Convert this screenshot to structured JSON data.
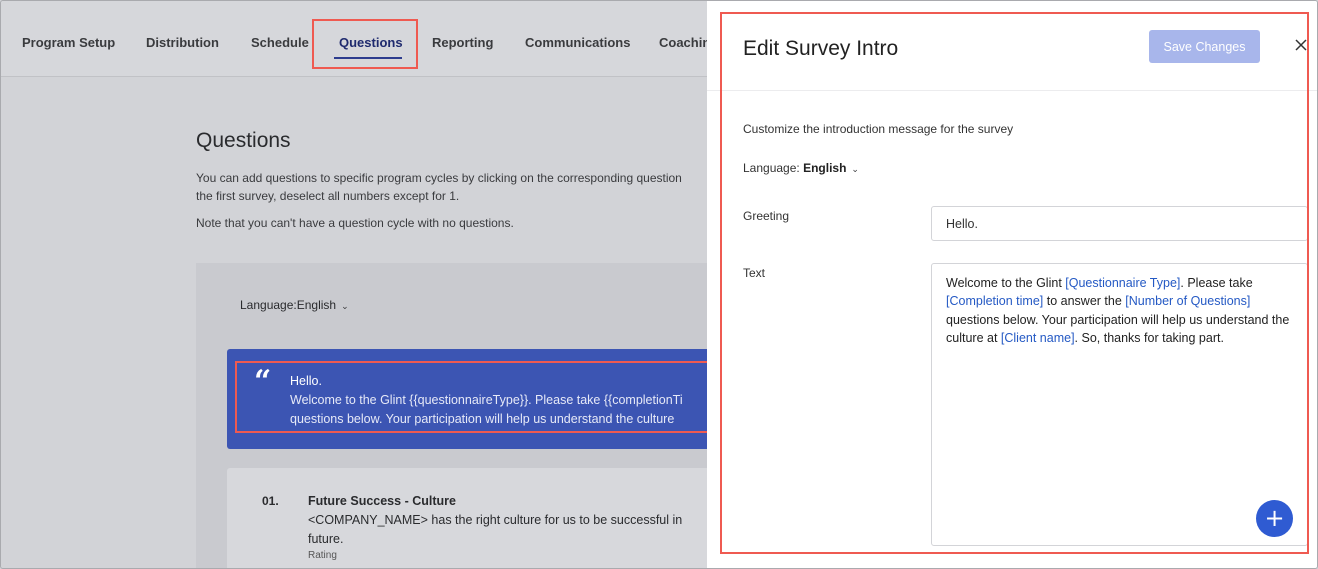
{
  "nav": {
    "tabs": [
      {
        "label": "Program Setup"
      },
      {
        "label": "Distribution"
      },
      {
        "label": "Schedule"
      },
      {
        "label": "Questions"
      },
      {
        "label": "Reporting"
      },
      {
        "label": "Communications"
      },
      {
        "label": "Coachin"
      }
    ],
    "active_tab": "Questions"
  },
  "page": {
    "title": "Questions",
    "description_line1": "You can add questions to specific program cycles by clicking on the corresponding question",
    "description_line2": "the first survey, deselect all numbers except for 1.",
    "note": "Note that you can't have a question cycle with no questions.",
    "language_label": "Language:",
    "language_value": "English"
  },
  "intro_card": {
    "greeting": "Hello.",
    "text_line1": "Welcome to the Glint {{questionnaireType}}. Please take {{completionTi",
    "text_line2": "questions below. Your participation will help us understand the culture"
  },
  "question": {
    "number": "01.",
    "title": "Future Success - Culture",
    "text_line1": "<COMPANY_NAME> has the right culture for us to be successful in",
    "text_line2": "future.",
    "type": "Rating"
  },
  "drawer": {
    "title": "Edit Survey Intro",
    "save_label": "Save Changes",
    "subtitle": "Customize the introduction message for the survey",
    "language_label": "Language:",
    "language_value": "English",
    "greeting_label": "Greeting",
    "greeting_value": "Hello.",
    "text_label": "Text",
    "text_parts": {
      "p1": "Welcome to the Glint ",
      "t1": "[Questionnaire Type]",
      "p2": ". Please take ",
      "t2": "[Completion time]",
      "p3": " to answer the ",
      "t3": "[Number of Questions]",
      "p4": " questions below. Your participation will help us understand the culture at ",
      "t4": "[Client name]",
      "p5": ". So, thanks for taking part."
    },
    "add_label": "+"
  },
  "colors": {
    "accent": "#3c55b3",
    "callout": "#ef5a51",
    "save_button": "#a8b6eb",
    "token": "#2459c4",
    "add_button": "#2f5bd2"
  },
  "icons": [
    "chevron-down-icon",
    "quote-icon",
    "close-icon",
    "plus-icon"
  ]
}
